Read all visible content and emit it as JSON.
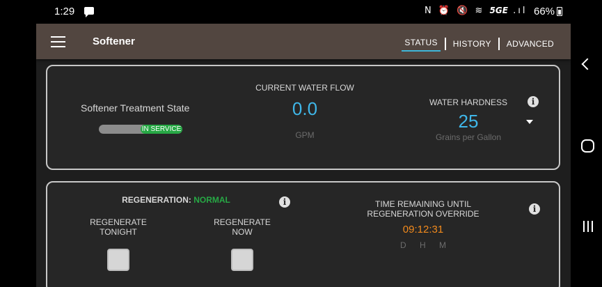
{
  "status_bar": {
    "time": "1:29",
    "icons": "N ⏰ 🔇 ≋",
    "network": "5GE",
    "signal": ".ıl",
    "battery": "66%"
  },
  "app_bar": {
    "title": "Softener",
    "tabs": [
      {
        "label": "STATUS",
        "active": true
      },
      {
        "label": "HISTORY",
        "active": false
      },
      {
        "label": "ADVANCED",
        "active": false
      }
    ]
  },
  "status_card": {
    "treatment_label": "Softener Treatment State",
    "treatment_state": "IN SERVICE",
    "flow_label": "CURRENT WATER FLOW",
    "flow_value": "0.0",
    "flow_unit": "GPM",
    "hardness_label": "WATER HARDNESS",
    "hardness_value": "25",
    "hardness_unit": "Grains per Gallon"
  },
  "regen_card": {
    "title_prefix": "REGENERATION:",
    "status": "NORMAL",
    "tonight_label": "REGENERATE TONIGHT",
    "now_label": "REGENERATE NOW",
    "remaining_label": "TIME REMAINING UNTIL REGENERATION OVERRIDE",
    "remaining_value": "09:12:31",
    "remaining_units": "D H M"
  },
  "colors": {
    "accent": "#3fb6e8",
    "success": "#27a845",
    "warning": "#f28a1c",
    "app_bar": "#524640"
  },
  "icons": {
    "menu": "hamburger-menu-icon",
    "info": "info-icon",
    "dropdown": "dropdown-arrow-icon"
  },
  "info_glyph": "i"
}
